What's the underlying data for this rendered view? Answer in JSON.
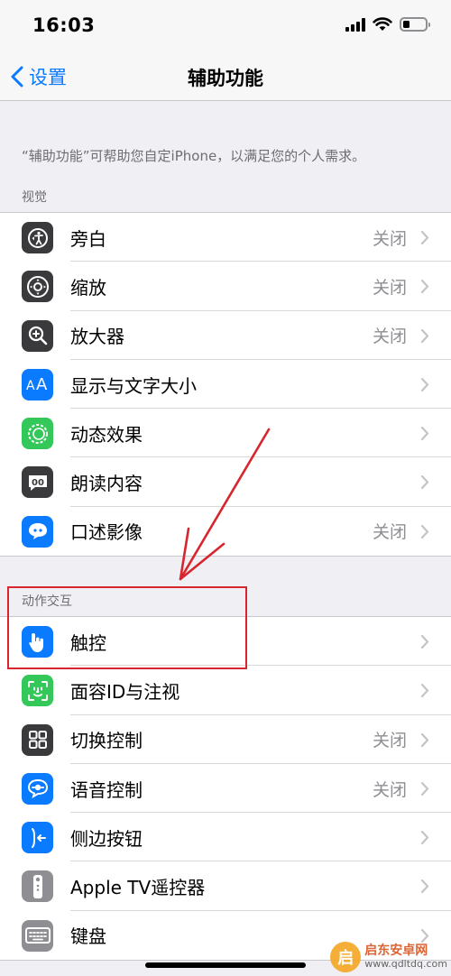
{
  "status_bar": {
    "time": "16:03",
    "battery_level": 0.3
  },
  "nav": {
    "back_label": "设置",
    "title": "辅助功能"
  },
  "intro": "“辅助功能”可帮助您自定iPhone，以满足您的个人需求。",
  "sections": [
    {
      "header": "视觉",
      "items": [
        {
          "label": "旁白",
          "value": "关闭",
          "icon": "voiceover-icon",
          "color": "#3a3a3c"
        },
        {
          "label": "缩放",
          "value": "关闭",
          "icon": "zoom-icon",
          "color": "#3a3a3c"
        },
        {
          "label": "放大器",
          "value": "关闭",
          "icon": "magnifier-icon",
          "color": "#3a3a3c"
        },
        {
          "label": "显示与文字大小",
          "value": "",
          "icon": "display-text-size-icon",
          "color": "#0a7aff"
        },
        {
          "label": "动态效果",
          "value": "",
          "icon": "motion-icon",
          "color": "#34c759"
        },
        {
          "label": "朗读内容",
          "value": "",
          "icon": "spoken-content-icon",
          "color": "#3a3a3c"
        },
        {
          "label": "口述影像",
          "value": "关闭",
          "icon": "audio-descriptions-icon",
          "color": "#0a7aff"
        }
      ]
    },
    {
      "header": "动作交互",
      "items": [
        {
          "label": "触控",
          "value": "",
          "icon": "touch-icon",
          "color": "#0a7aff"
        },
        {
          "label": "面容ID与注视",
          "value": "",
          "icon": "face-id-icon",
          "color": "#34c759"
        },
        {
          "label": "切换控制",
          "value": "关闭",
          "icon": "switch-control-icon",
          "color": "#3a3a3c"
        },
        {
          "label": "语音控制",
          "value": "关闭",
          "icon": "voice-control-icon",
          "color": "#0a7aff"
        },
        {
          "label": "侧边按钮",
          "value": "",
          "icon": "side-button-icon",
          "color": "#0a7aff"
        },
        {
          "label": "Apple TV遥控器",
          "value": "",
          "icon": "apple-tv-remote-icon",
          "color": "#8e8e93"
        },
        {
          "label": "键盘",
          "value": "",
          "icon": "keyboard-icon",
          "color": "#8e8e93"
        }
      ]
    }
  ],
  "watermark": {
    "name": "启东安卓网",
    "url": "www.qdltdq.com",
    "logo_char": "启"
  },
  "colors": {
    "accent": "#0a7aff",
    "annotation": "#d7262e"
  }
}
